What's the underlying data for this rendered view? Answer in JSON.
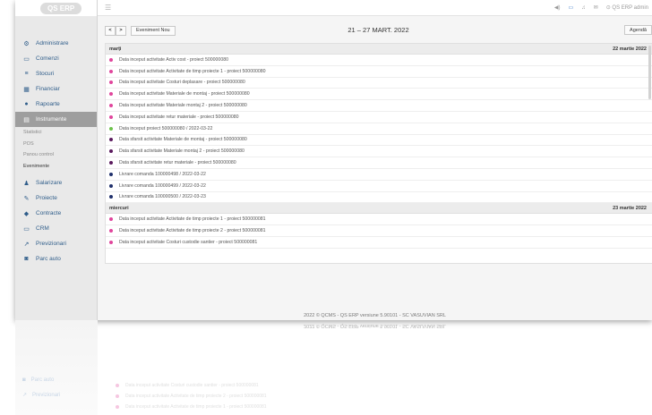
{
  "app": {
    "logo": "QS ERP"
  },
  "topbar": {
    "user": "QS ERP admin"
  },
  "sidebar": {
    "items_top": [
      {
        "label": "Administrare",
        "icon": "gear-icon",
        "glyph": "⚙"
      },
      {
        "label": "Comenzi",
        "icon": "cart-icon",
        "glyph": "▭"
      },
      {
        "label": "Stocuri",
        "icon": "stock-icon",
        "glyph": "≡"
      },
      {
        "label": "Financiar",
        "icon": "calculator-icon",
        "glyph": "▦"
      },
      {
        "label": "Rapoarte",
        "icon": "chart-icon",
        "glyph": "●"
      },
      {
        "label": "Instrumente",
        "icon": "tools-icon",
        "glyph": "▤"
      }
    ],
    "sub_items": [
      "Statistici",
      "POS",
      "Panou control",
      "Evenimente"
    ],
    "items_bottom": [
      {
        "label": "Salarizare",
        "icon": "users-icon",
        "glyph": "♟"
      },
      {
        "label": "Proiecte",
        "icon": "wrench-icon",
        "glyph": "✎"
      },
      {
        "label": "Contracte",
        "icon": "contract-icon",
        "glyph": "◆"
      },
      {
        "label": "CRM",
        "icon": "crm-icon",
        "glyph": "▭"
      },
      {
        "label": "Previzionari",
        "icon": "trend-icon",
        "glyph": "↗"
      },
      {
        "label": "Parc auto",
        "icon": "car-icon",
        "glyph": "◙"
      }
    ]
  },
  "toolbar": {
    "prev_label": "<",
    "next_label": ">",
    "new_event_label": "Eveniment Nou",
    "range_title": "21 – 27 MART. 2022",
    "agenda_label": "Agendă"
  },
  "colors": {
    "pink": "#e0459c",
    "green": "#6cc24a",
    "purple": "#5b1a5e",
    "navy": "#1f2f6b"
  },
  "days": [
    {
      "day_name": "marți",
      "date": "22 martie 2022",
      "events": [
        {
          "text": "Data inceput activitate Activ cost - proiect 500000080",
          "color": "#e0459c"
        },
        {
          "text": "Data inceput activitate Activitate de timp proiecte 1 - proiect 500000080",
          "color": "#e0459c"
        },
        {
          "text": "Data inceput activitate Costuri deplasare - proiect 500000080",
          "color": "#e0459c"
        },
        {
          "text": "Data inceput activitate Materiale de montaj - proiect 500000080",
          "color": "#e0459c"
        },
        {
          "text": "Data inceput activitate Materiale montaj 2 - proiect 500000080",
          "color": "#e0459c"
        },
        {
          "text": "Data inceput activitate retur materiale - proiect 500000080",
          "color": "#e0459c"
        },
        {
          "text": "Data inceput proiect 500000080 / 2022-03-22",
          "color": "#6cc24a"
        },
        {
          "text": "Data sfarsit activitate Materiale de montaj - proiect 500000080",
          "color": "#5b1a5e"
        },
        {
          "text": "Data sfarsit activitate Materiale montaj 2 - proiect 500000080",
          "color": "#5b1a5e"
        },
        {
          "text": "Data sfarsit activitate retur materiale - proiect 500000080",
          "color": "#5b1a5e"
        },
        {
          "text": "Livrare comanda 100000498 / 2022-03-22",
          "color": "#1f2f6b"
        },
        {
          "text": "Livrare comanda 100000499 / 2022-03-22",
          "color": "#1f2f6b"
        },
        {
          "text": "Livrare comanda 100000500 / 2022-03-23",
          "color": "#1f2f6b"
        }
      ]
    },
    {
      "day_name": "miercuri",
      "date": "23 martie 2022",
      "events": [
        {
          "text": "Data inceput activitate Activitate de timp proiecte 1 - proiect 500000081",
          "color": "#e0459c"
        },
        {
          "text": "Data inceput activitate Activitate de timp proiecte 2 - proiect 500000081",
          "color": "#e0459c"
        },
        {
          "text": "Data inceput activitate Costuri custodie santier - proiect 500000081",
          "color": "#e0459c"
        }
      ]
    }
  ],
  "footer": {
    "text": "2022 © QCMS - QS ERP versiune 5.90101 - SC VASUVIAN SRL"
  }
}
